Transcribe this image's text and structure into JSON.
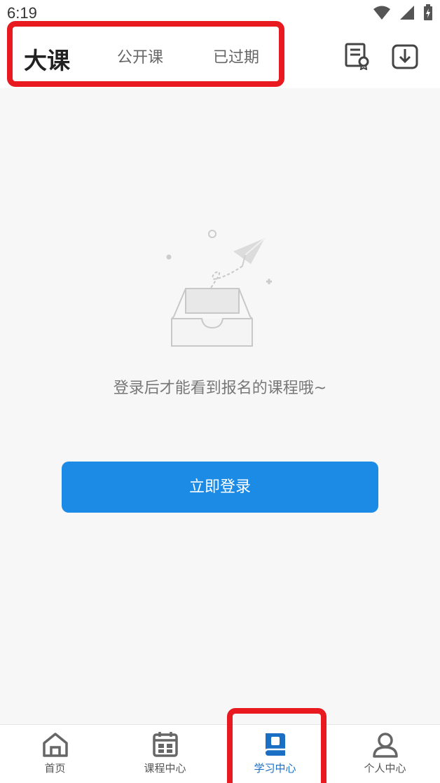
{
  "status_bar": {
    "time": "6:19"
  },
  "header": {
    "tabs": [
      {
        "label": "大课",
        "active": true
      },
      {
        "label": "公开课",
        "active": false
      },
      {
        "label": "已过期",
        "active": false
      }
    ],
    "icons": [
      "certificate-icon",
      "download-icon"
    ]
  },
  "empty_state": {
    "message": "登录后才能看到报名的课程哦~",
    "button_label": "立即登录"
  },
  "bottom_nav": {
    "items": [
      {
        "label": "首页",
        "icon": "home-icon",
        "active": false
      },
      {
        "label": "课程中心",
        "icon": "calendar-icon",
        "active": false
      },
      {
        "label": "学习中心",
        "icon": "book-icon",
        "active": true
      },
      {
        "label": "个人中心",
        "icon": "person-icon",
        "active": false
      }
    ]
  },
  "colors": {
    "accent": "#1b8be6",
    "active_nav": "#1a6fc4",
    "highlight": "#e8191f"
  }
}
